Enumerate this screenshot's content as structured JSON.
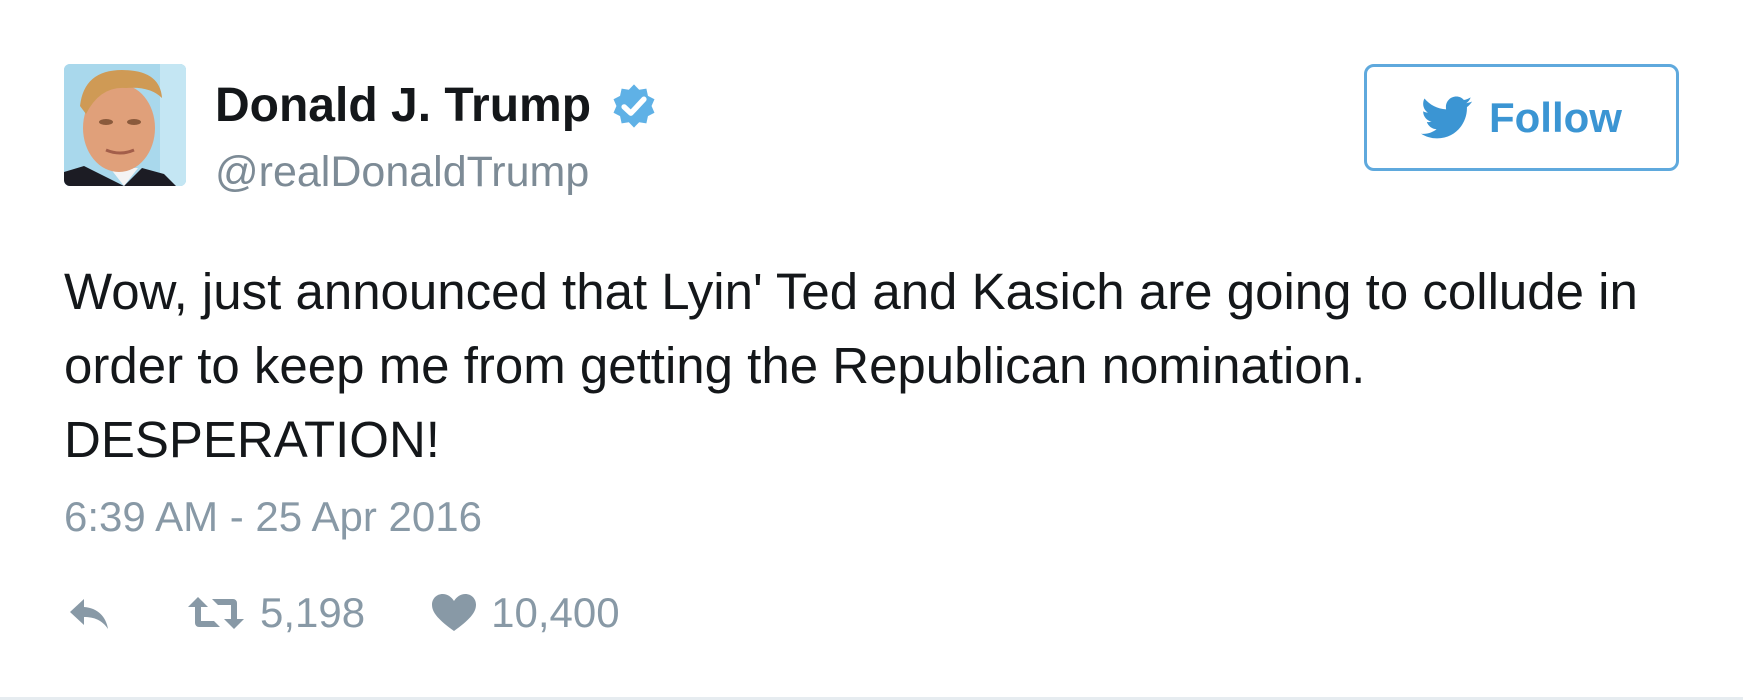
{
  "author": {
    "name": "Donald J. Trump",
    "handle": "@realDonaldTrump",
    "verified": true,
    "avatar_icon": "profile-photo"
  },
  "follow_button": {
    "label": "Follow",
    "icon": "twitter-bird-icon",
    "color": "#3b95d3"
  },
  "tweet": {
    "lines": [
      "Wow, just announced that Lyin' Ted and Kasich are going to collude in",
      "order to keep me from getting the Republican nomination.",
      "DESPERATION!"
    ],
    "timestamp": "6:39 AM - 25 Apr 2016"
  },
  "actions": {
    "reply": {
      "icon": "reply-icon"
    },
    "retweet": {
      "icon": "retweet-icon",
      "count": "5,198"
    },
    "like": {
      "icon": "heart-icon",
      "count": "10,400"
    }
  },
  "colors": {
    "text": "#14171a",
    "muted": "#8899a6",
    "accent": "#3b95d3",
    "verified": "#5fb1e6"
  }
}
